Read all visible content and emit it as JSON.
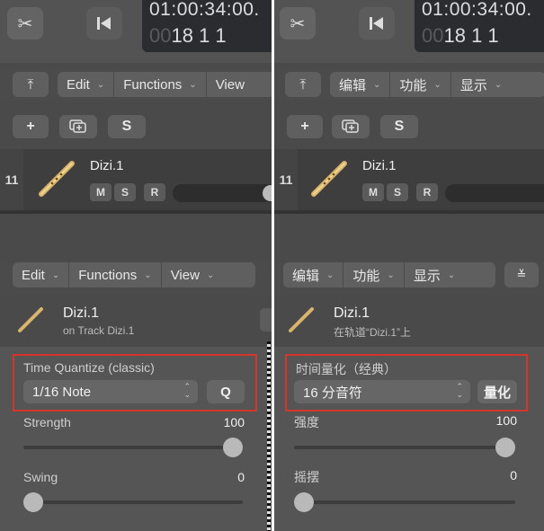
{
  "left": {
    "lcd": {
      "time": "01:00:34:00.",
      "bars_dim": "00",
      "bars": "18  1  1"
    },
    "tool_icon": "scissors-icon",
    "rewind_icon": "rewind-to-start-icon",
    "up_arrow": "⤒",
    "menu_top": {
      "edit": "Edit",
      "functions": "Functions",
      "view": "View"
    },
    "add_label": "+",
    "s_label": "S",
    "track": {
      "number": "11",
      "name": "Dizi.1",
      "m": "M",
      "s": "S",
      "r": "R"
    },
    "menu_inspector": {
      "edit": "Edit",
      "functions": "Functions",
      "view": "View"
    },
    "region": {
      "name": "Dizi.1",
      "sub": "on Track Dizi.1"
    },
    "quantize": {
      "title": "Time Quantize (classic)",
      "value": "1/16 Note",
      "button": "Q"
    },
    "strength": {
      "label": "Strength",
      "value": "100",
      "level": 1.0
    },
    "swing": {
      "label": "Swing",
      "value": "0",
      "level": 0.0
    }
  },
  "right": {
    "lcd": {
      "time": "01:00:34:00.",
      "bars_dim": "00",
      "bars": "18  1  1"
    },
    "up_arrow": "⤒",
    "menu_top": {
      "edit": "编辑",
      "functions": "功能",
      "view": "显示"
    },
    "add_label": "+",
    "s_label": "S",
    "track": {
      "number": "11",
      "name": "Dizi.1",
      "m": "M",
      "s": "S",
      "r": "R"
    },
    "menu_inspector": {
      "edit": "编辑",
      "functions": "功能",
      "view": "显示"
    },
    "region": {
      "name": "Dizi.1",
      "sub": "在轨道“Dizi.1”上"
    },
    "quantize": {
      "title": "时间量化（经典）",
      "value": "16 分音符",
      "button": "量化"
    },
    "strength": {
      "label": "强度",
      "value": "100",
      "level": 1.0
    },
    "swing": {
      "label": "摇摆",
      "value": "0",
      "level": 0.0
    }
  },
  "colors": {
    "highlight": "#d6352a",
    "panel": "#4a4a4a",
    "lcd": "#2b2c30"
  }
}
